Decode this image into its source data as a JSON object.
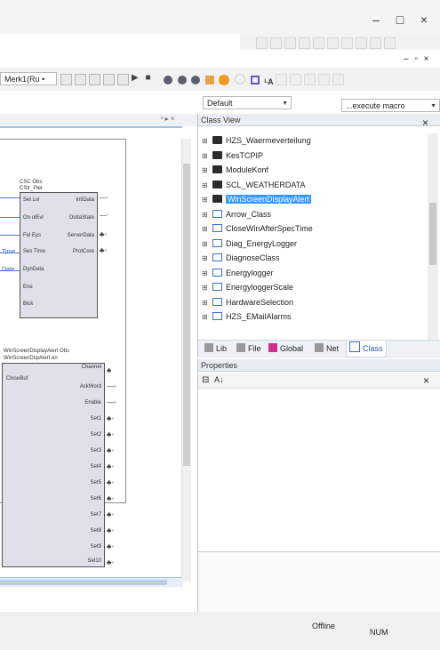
{
  "window": {
    "minimize_glyph": "–",
    "maximize_glyph": "□",
    "close_glyph": "×",
    "doc_minimize_glyph": "–",
    "doc_restore_glyph": "▫",
    "doc_close_glyph": "×"
  },
  "toolbar": {
    "project_combo": "Merk1(Ru •"
  },
  "combos": {
    "layout": "Default",
    "macro": "...execute macro"
  },
  "tabstrip": {
    "pin_close": "⁴ ▸ ×"
  },
  "class_view": {
    "title": "Class View",
    "close": "×",
    "items": [
      {
        "label": "HZS_Waermeverteilung",
        "icon": "folder-icon",
        "selected": false
      },
      {
        "label": "KesTCPIP",
        "icon": "folder-icon",
        "selected": false
      },
      {
        "label": "ModuleKonf",
        "icon": "folder-icon",
        "selected": false
      },
      {
        "label": "SCL_WEATHERDATA",
        "icon": "folder-icon",
        "selected": false
      },
      {
        "label": "WinScreenDisplayAlert",
        "icon": "folder-icon",
        "selected": true
      },
      {
        "label": "Arrow_Class",
        "icon": "class-icon",
        "selected": false
      },
      {
        "label": "CloseWinAfterSpecTime",
        "icon": "class-icon",
        "selected": false
      },
      {
        "label": "Diag_EnergyLogger",
        "icon": "class-icon",
        "selected": false
      },
      {
        "label": "DiagnoseClass",
        "icon": "class-icon",
        "selected": false
      },
      {
        "label": "Energylogger",
        "icon": "class-icon",
        "selected": false
      },
      {
        "label": "EnergyloggerScale",
        "icon": "class-icon",
        "selected": false
      },
      {
        "label": "HardwareSelection",
        "icon": "class-icon",
        "selected": false
      },
      {
        "label": "HZS_EMailAlarms",
        "icon": "class-icon",
        "selected": false
      }
    ],
    "tabs": [
      {
        "label": "Lib",
        "icon": "library-icon"
      },
      {
        "label": "File",
        "icon": "file-icon"
      },
      {
        "label": "Global",
        "icon": "global-icon"
      },
      {
        "label": "Net",
        "icon": "net-icon"
      },
      {
        "label": "Class",
        "icon": "class-icon"
      }
    ]
  },
  "properties": {
    "title": "Properties",
    "sort_categorized": "⊟",
    "sort_alpha": "A↓",
    "close": "×"
  },
  "canvas": {
    "block1": {
      "header": "CSC Obs",
      "name": "CStr_Plet",
      "inputs": [
        "Set Lvl",
        "On ulEvl",
        "Fel Eys",
        "Ses Time",
        "DynData",
        "Ene",
        "Blck"
      ],
      "outputs": [
        "InitData",
        "OutlaState",
        "ServerData",
        "ProtCore"
      ],
      "wire_labels": [
        "Time",
        "Date"
      ]
    },
    "block2": {
      "header": "WinScreenDisplayAlert Obs",
      "name": "WinScreenDspAlert en",
      "inputs": [
        "CloseBuf"
      ],
      "outputs": [
        "Channel",
        "AckWord",
        "Enable",
        "Set1",
        "Set2",
        "Set3",
        "Set4",
        "Set5",
        "Set6",
        "Set7",
        "Set8",
        "Set9",
        "Set10"
      ]
    }
  },
  "status": {
    "left": "Offline",
    "right": "NUM"
  },
  "colors": {
    "accent": "#3b8de0",
    "wire": "#4a78c8",
    "selection": "#3399ff",
    "orange": "#f39b1b",
    "magenta": "#d12f8a"
  }
}
